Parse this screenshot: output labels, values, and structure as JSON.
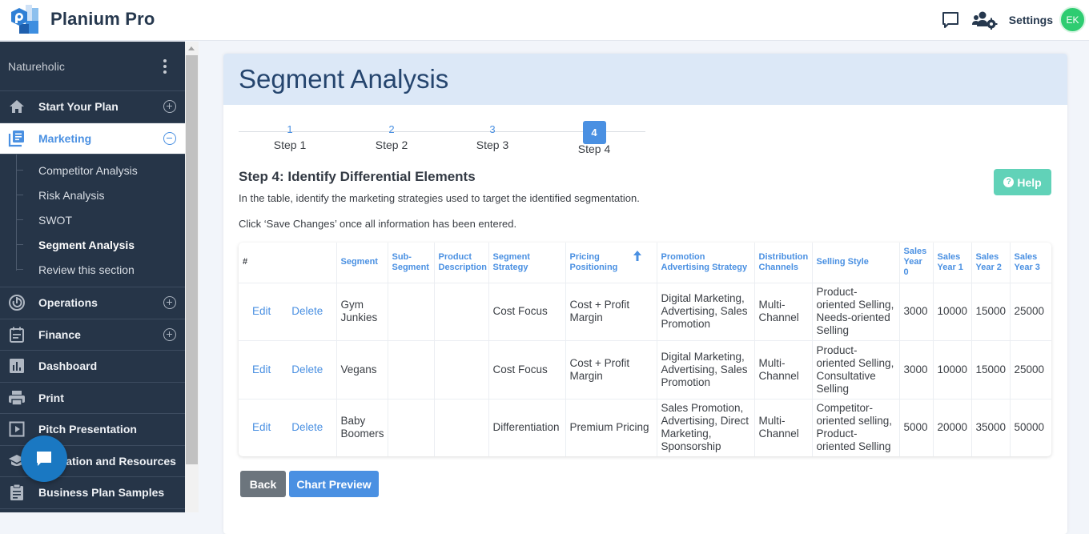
{
  "app": {
    "name": "Planium Pro"
  },
  "topbar": {
    "chat_icon": "chat-bubble-outline-icon",
    "team_icon": "users-gear-icon",
    "settings_label": "Settings",
    "avatar_initials": "EK",
    "avatar_color": "#2ecc71"
  },
  "sidebar": {
    "project_name": "Natureholic",
    "items": [
      {
        "label": "Start Your Plan",
        "icon": "home-icon",
        "toggle": "plus"
      },
      {
        "label": "Marketing",
        "icon": "marketing-icon",
        "toggle": "minus",
        "active": true,
        "children": [
          {
            "label": "Competitor Analysis"
          },
          {
            "label": "Risk Analysis"
          },
          {
            "label": "SWOT"
          },
          {
            "label": "Segment Analysis",
            "current": true
          },
          {
            "label": "Review this section"
          }
        ]
      },
      {
        "label": "Operations",
        "icon": "operations-icon",
        "toggle": "plus"
      },
      {
        "label": "Finance",
        "icon": "finance-icon",
        "toggle": "plus"
      },
      {
        "label": "Dashboard",
        "icon": "bar-chart-icon"
      },
      {
        "label": "Print",
        "icon": "printer-icon"
      },
      {
        "label": "Pitch Presentation",
        "icon": "play-icon"
      },
      {
        "label": "Education and Resources",
        "icon": "education-icon"
      },
      {
        "label": "Business Plan Samples",
        "icon": "clipboard-icon"
      }
    ]
  },
  "page": {
    "title": "Segment Analysis",
    "steps": [
      {
        "num": "1",
        "label": "Step 1"
      },
      {
        "num": "2",
        "label": "Step 2"
      },
      {
        "num": "3",
        "label": "Step 3"
      },
      {
        "num": "4",
        "label": "Step 4",
        "active": true
      }
    ],
    "section_title": "Step 4: Identify Differential Elements",
    "description": "In the table, identify the marketing strategies used to target the identified segmentation.",
    "instruction": "Click ‘Save Changes’ once all information has been entered.",
    "help_label": "Help",
    "accent_color": "#4a90e2",
    "help_color": "#61d2b8"
  },
  "table": {
    "columns": [
      "#",
      "Segment",
      "Sub-Segment",
      "Product Description",
      "Segment Strategy",
      "Pricing Positioning",
      "Promotion Advertising Strategy",
      "Distribution Channels",
      "Selling Style",
      "Sales Year 0",
      "Sales Year 1",
      "Sales Year 2",
      "Sales Year 3"
    ],
    "sorted_column": "Pricing Positioning",
    "sort_direction": "ascending",
    "edit_label": "Edit",
    "delete_label": "Delete",
    "rows": [
      {
        "segment": "Gym Junkies",
        "sub_segment": "",
        "product_description": "",
        "segment_strategy": "Cost Focus",
        "pricing": "Cost + Profit Margin",
        "promotion": "Digital Marketing, Advertising, Sales Promotion",
        "distribution": "Multi-Channel",
        "selling_style": "Product-oriented Selling, Needs-oriented Selling",
        "y0": "3000",
        "y1": "10000",
        "y2": "15000",
        "y3": "25000"
      },
      {
        "segment": "Vegans",
        "sub_segment": "",
        "product_description": "",
        "segment_strategy": "Cost Focus",
        "pricing": "Cost + Profit Margin",
        "promotion": "Digital Marketing, Advertising, Sales Promotion",
        "distribution": "Multi-Channel",
        "selling_style": "Product-oriented Selling, Consultative Selling",
        "y0": "3000",
        "y1": "10000",
        "y2": "15000",
        "y3": "25000"
      },
      {
        "segment": "Baby Boomers",
        "sub_segment": "",
        "product_description": "",
        "segment_strategy": "Differentiation",
        "pricing": "Premium Pricing",
        "promotion": "Sales Promotion, Advertising, Direct Marketing, Sponsorship",
        "distribution": "Multi-Channel",
        "selling_style": "Competitor-oriented selling, Product-oriented Selling",
        "y0": "5000",
        "y1": "20000",
        "y2": "35000",
        "y3": "50000"
      }
    ]
  },
  "buttons": {
    "back": "Back",
    "chart_preview": "Chart Preview"
  }
}
